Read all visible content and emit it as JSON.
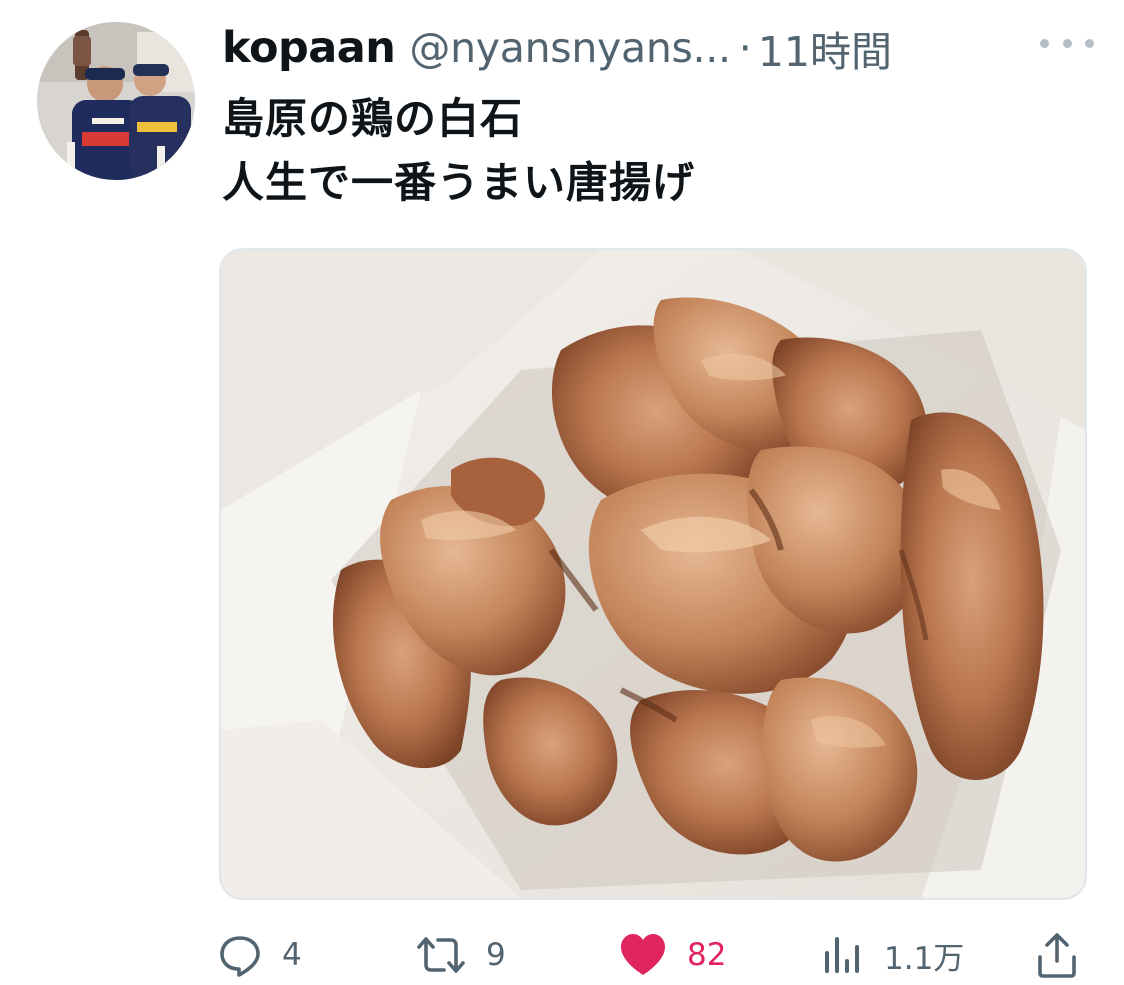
{
  "tweet": {
    "display_name": "kopaan",
    "handle": "@nyansnyans...",
    "separator": "·",
    "time": "11時間",
    "text_lines": [
      "島原の鶏の白石",
      "人生で一番うまい唐揚げ"
    ]
  },
  "media": {
    "subject": "karaage-fried-chicken-in-paper"
  },
  "actions": {
    "reply_count": "4",
    "retweet_count": "9",
    "like_count": "82",
    "views_count": "1.1万"
  },
  "colors": {
    "text_primary": "#0f1419",
    "text_secondary": "#536471",
    "like_pink": "#e0245e",
    "border": "#e1e6ea"
  },
  "icons": {
    "reply": "speech-bubble",
    "retweet": "retweet-arrows",
    "like": "heart-filled",
    "views": "bar-chart",
    "share": "upload-arrow",
    "more": "ellipsis-horizontal"
  }
}
